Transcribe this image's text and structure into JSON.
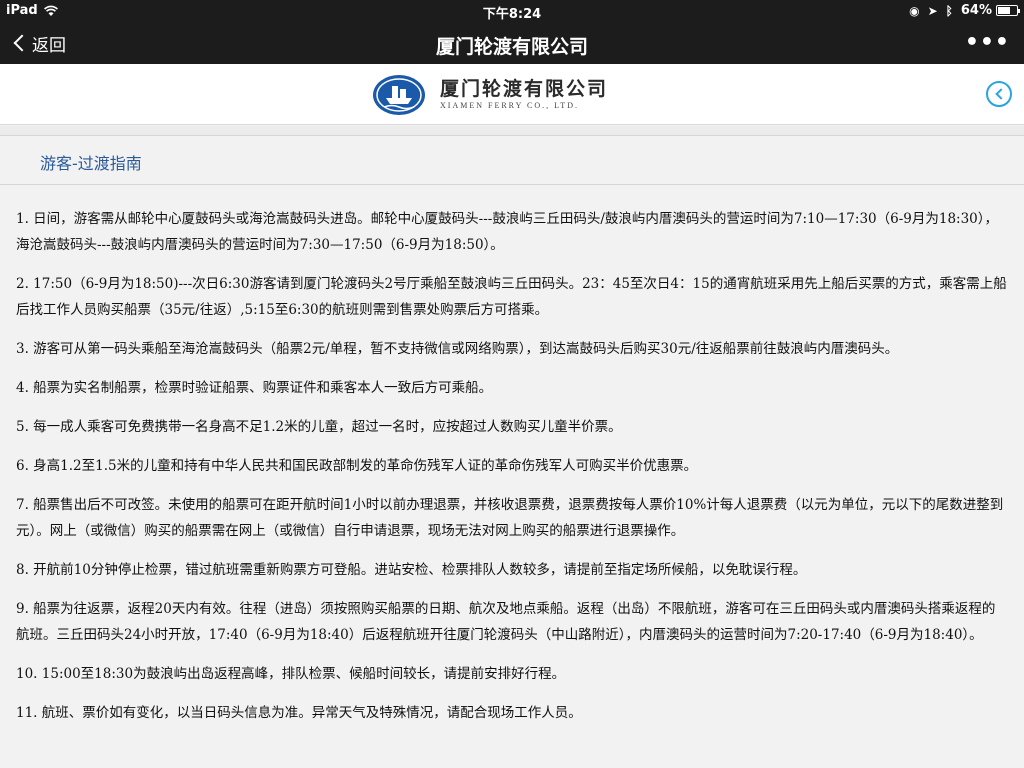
{
  "status_bar": {
    "device": "iPad",
    "time": "下午8:24",
    "battery": "64%",
    "battery_level": 0.64
  },
  "nav": {
    "back_label": "返回",
    "title": "厦门轮渡有限公司",
    "more_label": "•••"
  },
  "logo": {
    "name_cn": "厦门轮渡有限公司",
    "name_en": "XIAMEN FERRY CO., LTD."
  },
  "section": {
    "title": "游客-过渡指南"
  },
  "paragraphs": [
    "1.  日间，游客需从邮轮中心厦鼓码头或海沧嵩鼓码头进岛。邮轮中心厦鼓码头---鼓浪屿三丘田码头/鼓浪屿内厝澳码头的营运时间为7:10—17:30（6-9月为18:30），海沧嵩鼓码头---鼓浪屿内厝澳码头的营运时间为7:30—17:50（6-9月为18:50）。",
    "2.  17:50（6-9月为18:50)---次日6:30游客请到厦门轮渡码头2号厅乘船至鼓浪屿三丘田码头。23：45至次日4：15的通宵航班采用先上船后买票的方式，乘客需上船后找工作人员购买船票（35元/往返）,5:15至6:30的航班则需到售票处购票后方可搭乘。",
    "3.  游客可从第一码头乘船至海沧嵩鼓码头（船票2元/单程，暂不支持微信或网络购票），到达嵩鼓码头后购买30元/往返船票前往鼓浪屿内厝澳码头。",
    "4.  船票为实名制船票，检票时验证船票、购票证件和乘客本人一致后方可乘船。",
    "5.  每一成人乘客可免费携带一名身高不足1.2米的儿童，超过一名时，应按超过人数购买儿童半价票。",
    "6.  身高1.2至1.5米的儿童和持有中华人民共和国民政部制发的革命伤残军人证的革命伤残军人可购买半价优惠票。",
    "7.  船票售出后不可改签。未使用的船票可在距开航时间1小时以前办理退票，并核收退票费，退票费按每人票价10%计每人退票费（以元为单位，元以下的尾数进整到元）。网上（或微信）购买的船票需在网上（或微信）自行申请退票，现场无法对网上购买的船票进行退票操作。",
    "8.  开航前10分钟停止检票，错过航班需重新购票方可登船。进站安检、检票排队人数较多，请提前至指定场所候船，以免耽误行程。",
    "9.  船票为往返票，返程20天内有效。往程（进岛）须按照购买船票的日期、航次及地点乘船。返程（出岛）不限航班，游客可在三丘田码头或内厝澳码头搭乘返程的航班。三丘田码头24小时开放，17:40（6-9月为18:40）后返程航班开往厦门轮渡码头（中山路附近），内厝澳码头的运营时间为7:20-17:40（6-9月为18:40）。",
    "10.  15:00至18:30为鼓浪屿出岛返程高峰，排队检票、候船时间较长，请提前安排好行程。",
    "11.  航班、票价如有变化，以当日码头信息为准。异常天气及特殊情况，请配合现场工作人员。"
  ]
}
